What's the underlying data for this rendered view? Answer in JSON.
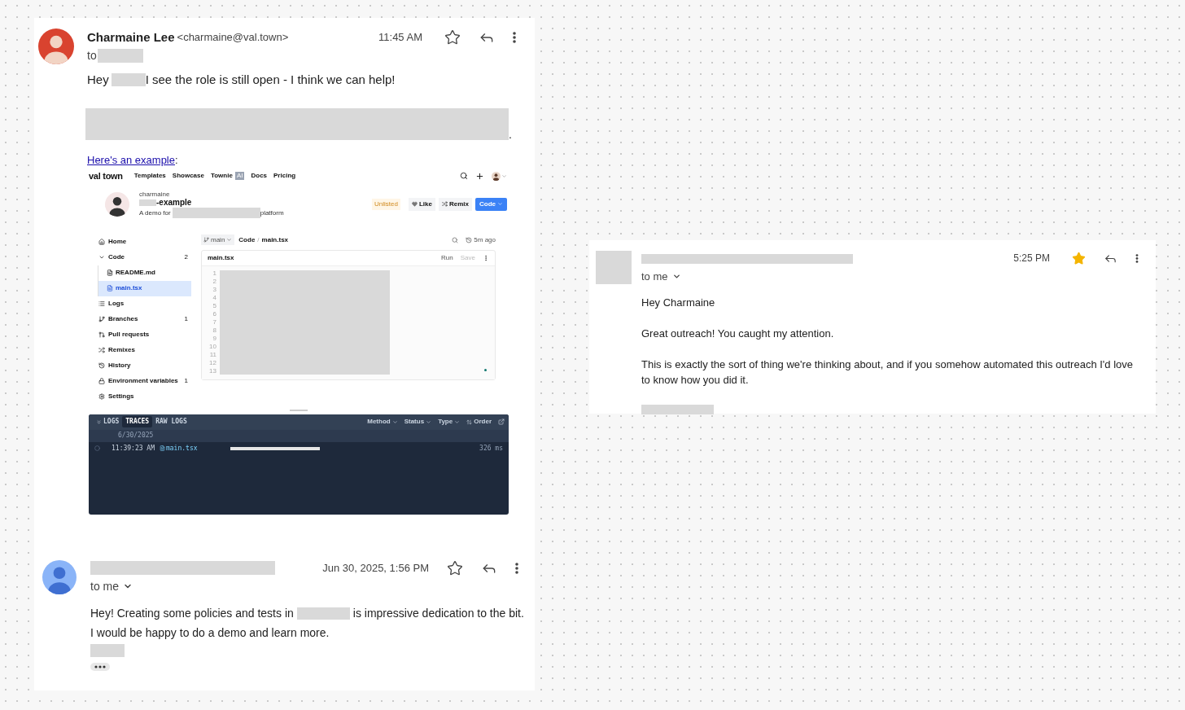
{
  "first_email": {
    "sender_name": "Charmaine Lee",
    "sender_email": "<charmaine@val.town>",
    "to_label": "to",
    "time": "11:45 AM",
    "starred": false,
    "greeting": "Hey",
    "opening": "I see the role is still open - I think we can help!",
    "trailing": ".",
    "link": "Here's an example",
    "link_suffix": ":"
  },
  "embedded_app": {
    "brand": "val town",
    "nav_links": [
      {
        "label": "Templates"
      },
      {
        "label": "Showcase"
      },
      {
        "label": "Townie",
        "badge": "AI"
      },
      {
        "label": "Docs"
      },
      {
        "label": "Pricing"
      }
    ],
    "project": {
      "owner": "charmaine",
      "name": "-example",
      "description_prefix": "A demo for",
      "description_suffix": "platform",
      "status": "Unlisted",
      "like": "Like",
      "remix": "Remix",
      "code": "Code"
    },
    "sidebar": [
      {
        "label": "Home",
        "selected": false
      },
      {
        "label": "Code",
        "count": "2",
        "expanded": true,
        "selected": false,
        "children": [
          {
            "label": "README.md",
            "selected": false
          },
          {
            "label": "main.tsx",
            "selected": true
          }
        ]
      },
      {
        "label": "Logs",
        "selected": false
      },
      {
        "label": "Branches",
        "count": "1",
        "selected": false
      },
      {
        "label": "Pull requests",
        "selected": false
      },
      {
        "label": "Remixes",
        "selected": false
      },
      {
        "label": "History",
        "selected": false
      },
      {
        "label": "Environment variables",
        "count": "1",
        "selected": false
      },
      {
        "label": "Settings",
        "selected": false
      }
    ],
    "editor": {
      "branch": "main",
      "breadcrumb": [
        "Code",
        "main.tsx"
      ],
      "breadcrumb_separator": "/",
      "updated": "5m ago",
      "file_tab": "main.tsx",
      "actions": [
        {
          "label": "Run",
          "disabled": false
        },
        {
          "label": "Save",
          "disabled": true
        }
      ],
      "line_numbers": [
        "1",
        "2",
        "3",
        "4",
        "5",
        "6",
        "7",
        "8",
        "9",
        "10",
        "11",
        "12",
        "13"
      ]
    },
    "logs": {
      "tabs": [
        {
          "label": "LOGS",
          "selected": false
        },
        {
          "label": "TRACES",
          "selected": true
        },
        {
          "label": "RAW LOGS",
          "selected": false
        }
      ],
      "filters": [
        {
          "label": "Method",
          "kind": "dropdown"
        },
        {
          "label": "Status",
          "kind": "dropdown"
        },
        {
          "label": "Type",
          "kind": "dropdown"
        },
        {
          "label": "Order",
          "kind": "sort"
        }
      ],
      "date": "6/30/2025",
      "rows": [
        {
          "time": "11:39:23 AM",
          "file": "main.tsx",
          "duration": "326 ms"
        }
      ]
    }
  },
  "second_email": {
    "time": "Jun 30, 2025, 1:56 PM",
    "starred": false,
    "to_label": "to me",
    "body_before": "Hey! Creating some policies and tests in",
    "body_after": "is impressive dedication to the bit.",
    "body_line_2": "I would be happy to do a demo and learn more."
  },
  "reply_email": {
    "time": "5:25 PM",
    "starred": true,
    "to_label": "to me",
    "paragraphs": [
      "Hey Charmaine",
      "Great outreach! You caught my attention.",
      "This is exactly the sort of thing we're thinking about, and if you somehow automated this outreach I'd love to know how you did it."
    ]
  }
}
